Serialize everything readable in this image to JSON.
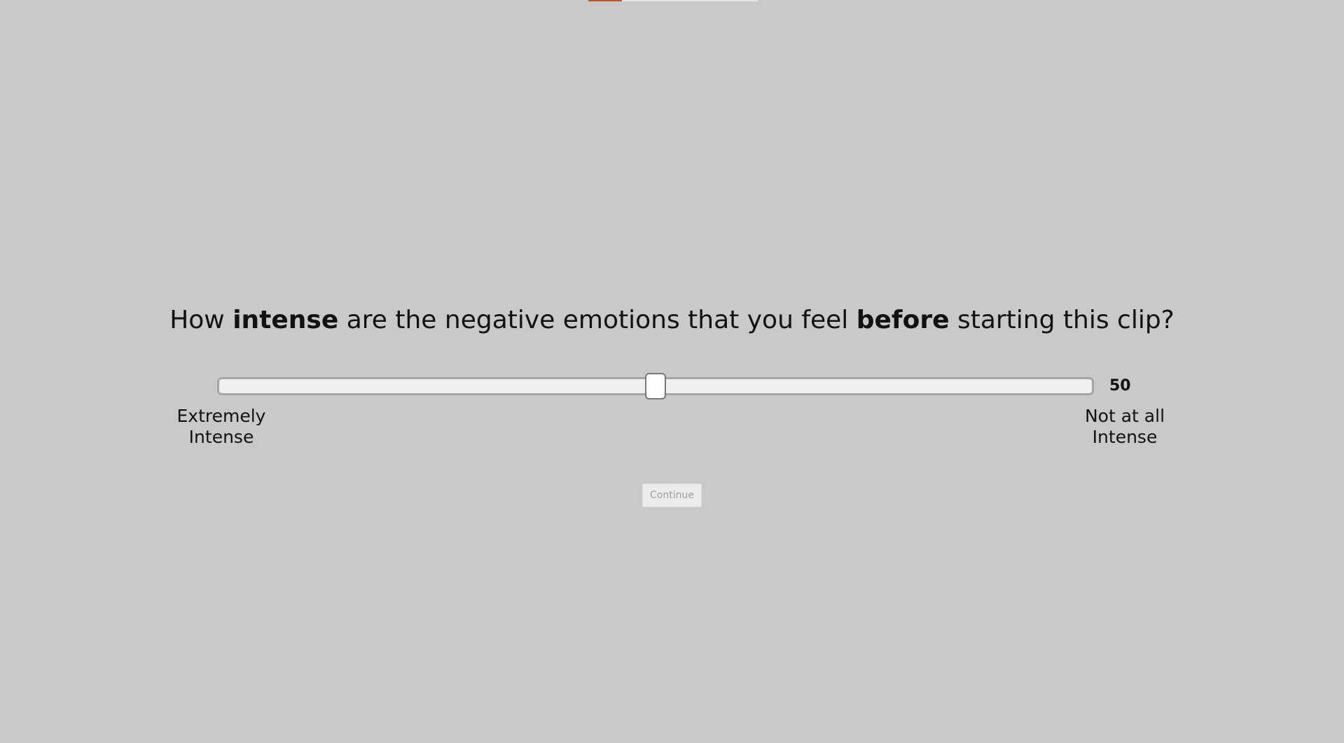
{
  "progress": {
    "value_fraction": 0.2,
    "fill_color": "#c0531e",
    "track_color": "#e6e6e6"
  },
  "question": {
    "part1": "How ",
    "bold1": "intense",
    "part2": " are the negative emotions that you feel ",
    "bold2": "before",
    "part3": " starting this clip?"
  },
  "slider": {
    "value": 50,
    "min": 0,
    "max": 100,
    "value_text": "50",
    "left_label_line1": "Extremely",
    "left_label_line2": "Intense",
    "right_label_line1": "Not at all",
    "right_label_line2": "Intense"
  },
  "continue_button": {
    "label": "Continue",
    "disabled": true
  },
  "colors": {
    "background": "#c9c9c9",
    "track": "#f0f0f0",
    "thumb": "#ffffff"
  }
}
